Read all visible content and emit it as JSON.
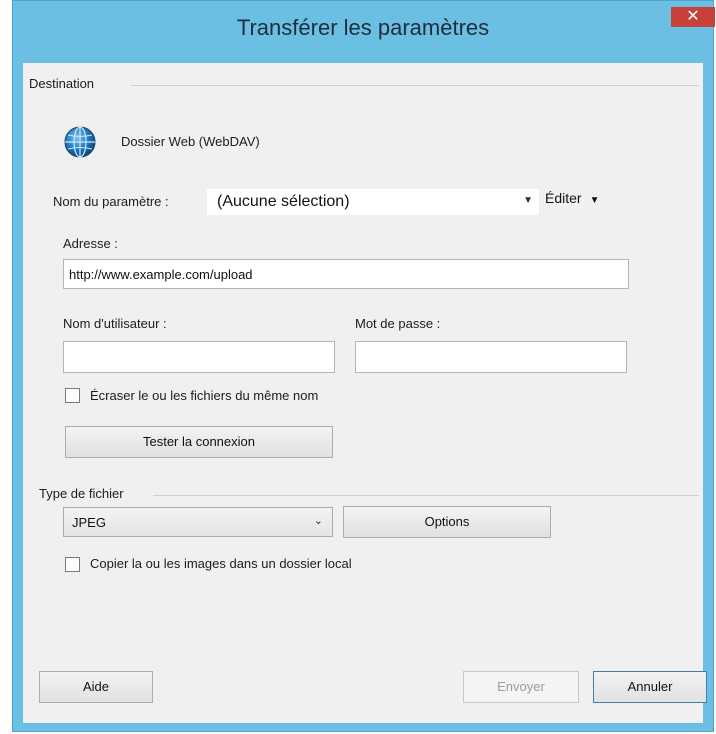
{
  "window": {
    "title": "Transférer les paramètres",
    "close_symbol": "✕"
  },
  "destination": {
    "group_title": "Destination",
    "server_icon": "globe-icon",
    "server_label": "Dossier Web (WebDAV)",
    "setting_name_label": "Nom du paramètre :",
    "setting_name_value": "(Aucune sélection)",
    "edit_label": "Éditer",
    "address_label": "Adresse :",
    "address_value": "http://www.example.com/upload",
    "username_label": "Nom d'utilisateur :",
    "username_value": "",
    "password_label": "Mot de passe :",
    "password_value": "",
    "overwrite_label": "Écraser le ou les fichiers du même nom",
    "overwrite_checked": false,
    "test_button": "Tester la connexion"
  },
  "file_type": {
    "group_title": "Type de fichier",
    "selected": "JPEG",
    "options_button": "Options",
    "copy_local_label": "Copier la ou les images dans un dossier local",
    "copy_local_checked": false
  },
  "footer": {
    "help_button": "Aide",
    "send_button": "Envoyer",
    "cancel_button": "Annuler"
  },
  "colors": {
    "frame": "#6bbfe3",
    "client": "#f0f0f0",
    "close": "#c7403a",
    "disabled_text": "#9c9c9c"
  }
}
